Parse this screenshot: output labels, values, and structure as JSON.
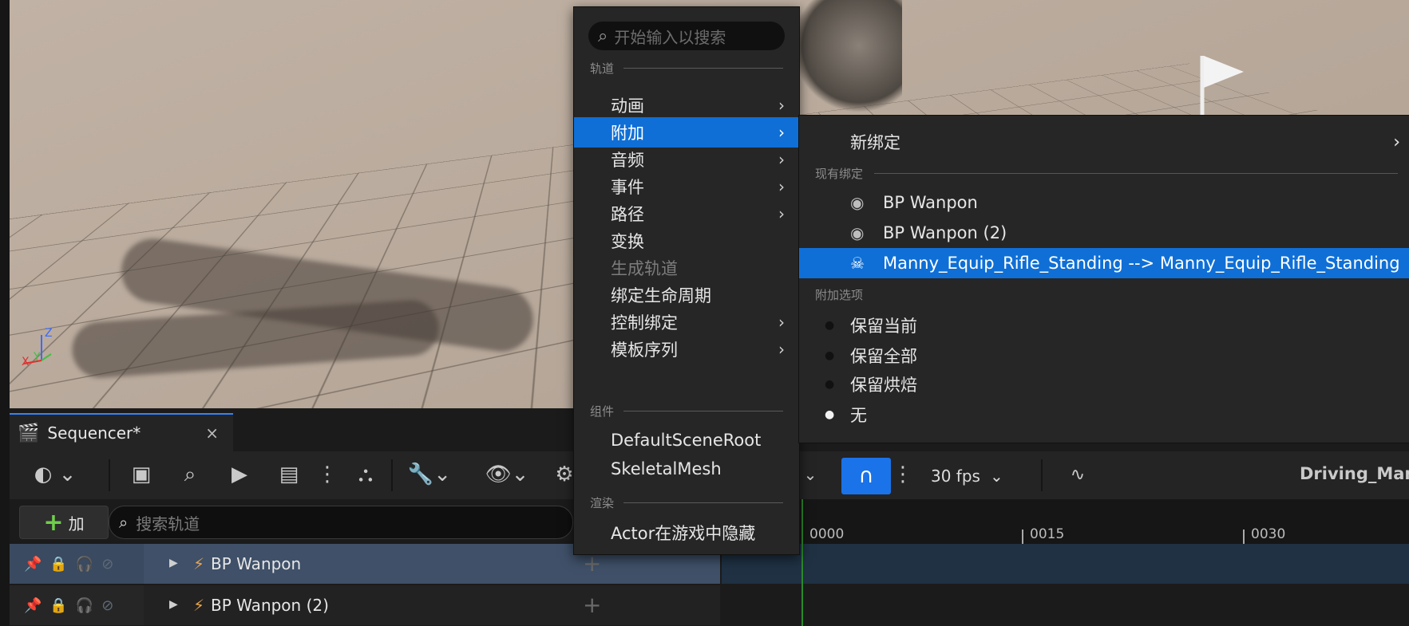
{
  "sequencer": {
    "tab_title": "Sequencer*",
    "close_glyph": "×",
    "add_label": "加",
    "search_placeholder": "搜索轨道",
    "fps_label": "30 fps",
    "sequence_name": "Driving_Mann",
    "tracks": [
      {
        "name": "BP Wanpon"
      },
      {
        "name": "BP Wanpon (2)"
      }
    ],
    "timeline_ticks": [
      "0000",
      "0015",
      "0030"
    ]
  },
  "menu": {
    "search_placeholder": "开始输入以搜索",
    "sections": {
      "tracks": "轨道",
      "components": "组件",
      "rendering": "渲染"
    },
    "items": [
      {
        "label": "动画",
        "submenu": true
      },
      {
        "label": "附加",
        "submenu": true,
        "selected": true
      },
      {
        "label": "音频",
        "submenu": true
      },
      {
        "label": "事件",
        "submenu": true
      },
      {
        "label": "路径",
        "submenu": true
      },
      {
        "label": "变换",
        "submenu": false
      },
      {
        "label": "生成轨道",
        "submenu": false,
        "disabled": true
      },
      {
        "label": "绑定生命周期",
        "submenu": false
      },
      {
        "label": "控制绑定",
        "submenu": true
      },
      {
        "label": "模板序列",
        "submenu": true
      }
    ],
    "components": [
      "DefaultSceneRoot",
      "SkeletalMesh"
    ],
    "rendering": [
      "Actor在游戏中隐藏"
    ]
  },
  "submenu": {
    "new_binding": "新绑定",
    "existing_section": "现有绑定",
    "existing": [
      "BP Wanpon",
      "BP Wanpon (2)",
      "Manny_Equip_Rifle_Standing --> Manny_Equip_Rifle_Standing"
    ],
    "options_section": "附加选项",
    "options": [
      {
        "label": "保留当前",
        "checked": false
      },
      {
        "label": "保留全部",
        "checked": false
      },
      {
        "label": "保留烘焙",
        "checked": false
      },
      {
        "label": "无",
        "checked": true
      }
    ]
  },
  "colors": {
    "selection": "#0f6fd6",
    "accent_green": "#6fcf4b",
    "snap_active": "#1a73e8"
  }
}
